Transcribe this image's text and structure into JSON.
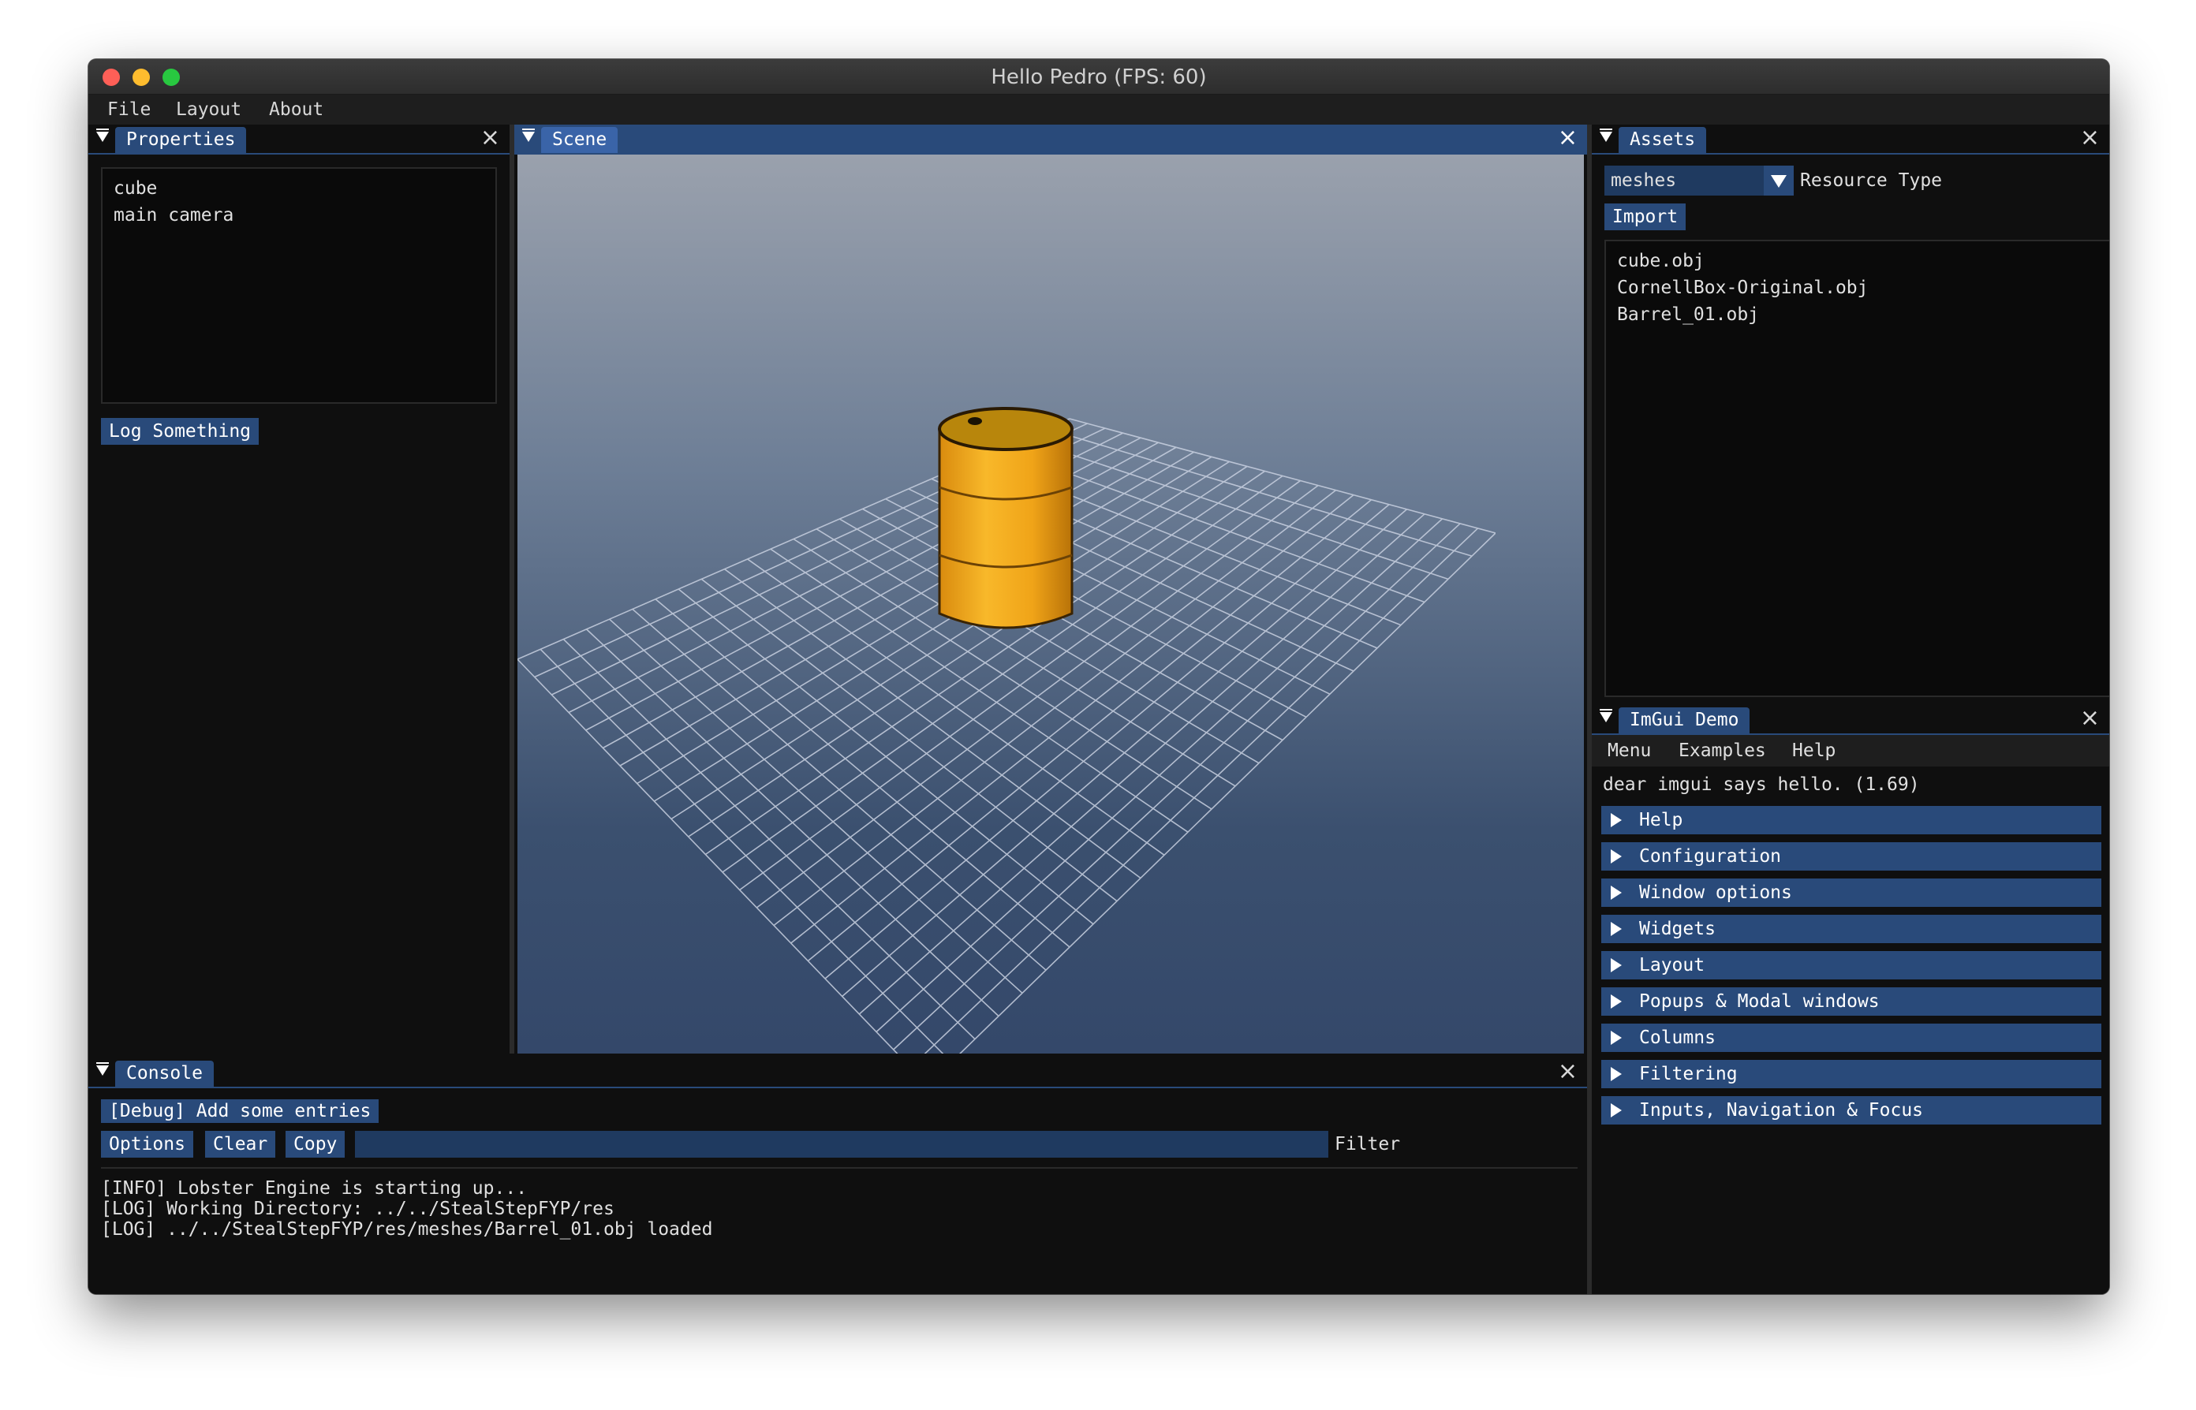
{
  "window": {
    "title": "Hello Pedro (FPS: 60)"
  },
  "menubar": {
    "items": [
      "File",
      "Layout",
      "About"
    ]
  },
  "properties": {
    "tab": "Properties",
    "items": [
      "cube",
      "main camera"
    ],
    "log_button": "Log Something"
  },
  "scene": {
    "tab": "Scene"
  },
  "assets": {
    "tab": "Assets",
    "combo_value": "meshes",
    "combo_label": "Resource Type",
    "import_button": "Import",
    "files": [
      "cube.obj",
      "CornellBox-Original.obj",
      "Barrel_01.obj"
    ]
  },
  "imgui_demo": {
    "tab": "ImGui Demo",
    "menu": [
      "Menu",
      "Examples",
      "Help"
    ],
    "hello": "dear imgui says hello. (1.69)",
    "sections": [
      "Help",
      "Configuration",
      "Window options",
      "Widgets",
      "Layout",
      "Popups & Modal windows",
      "Columns",
      "Filtering",
      "Inputs, Navigation & Focus"
    ]
  },
  "console": {
    "tab": "Console",
    "debug_button": "[Debug] Add some entries",
    "options_button": "Options",
    "clear_button": "Clear",
    "copy_button": "Copy",
    "filter_value": "",
    "filter_label": "Filter",
    "lines": [
      "[INFO] Lobster Engine is starting up...",
      "[LOG] Working Directory: ../../StealStepFYP/res",
      "[LOG] ../../StealStepFYP/res/meshes/Barrel_01.obj loaded"
    ]
  },
  "colors": {
    "accent": "#294a7a",
    "panel_bg": "#0f0f0f",
    "barrel": "#f0a818"
  }
}
